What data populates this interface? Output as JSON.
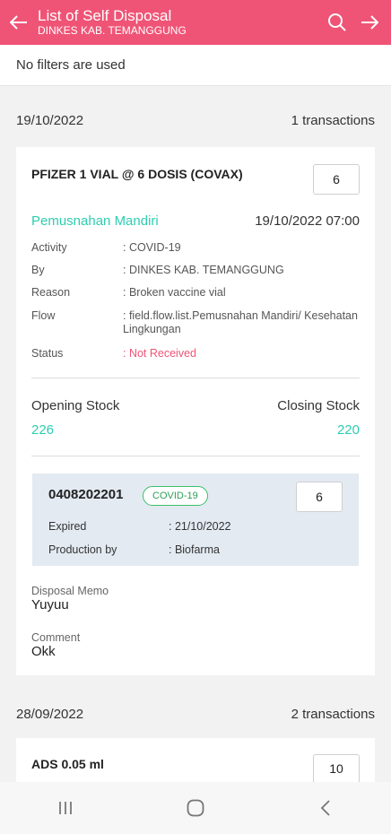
{
  "appbar": {
    "title": "List of Self Disposal",
    "subtitle": "DINKES KAB. TEMANGGUNG",
    "icons": [
      "back-arrow-icon",
      "search-icon",
      "forward-arrow-icon"
    ]
  },
  "filter": {
    "text": "No filters are used"
  },
  "groups": [
    {
      "date": "19/10/2022",
      "count": "1 transactions",
      "item": {
        "product": "PFIZER 1 VIAL @ 6 DOSIS (COVAX)",
        "qty": "6",
        "activity_title": "Pemusnahan Mandiri",
        "datetime": "19/10/2022 07:00",
        "details": {
          "activity": {
            "label": "Activity",
            "value": ": COVID-19"
          },
          "by": {
            "label": "By",
            "value": ": DINKES KAB. TEMANGGUNG"
          },
          "reason": {
            "label": "Reason",
            "value": ": Broken vaccine vial"
          },
          "flow": {
            "label": "Flow",
            "value": ": field.flow.list.Pemusnahan Mandiri/ Kesehatan Lingkungan"
          },
          "status": {
            "label": "Status",
            "value": ": Not Received"
          }
        },
        "stock": {
          "opening_label": "Opening Stock",
          "opening_value": "226",
          "closing_label": "Closing Stock",
          "closing_value": "220"
        },
        "batch": {
          "code": "0408202201",
          "tag": "COVID-19",
          "qty": "6",
          "expired_label": "Expired",
          "expired_value": ": 21/10/2022",
          "production_label": "Production by",
          "production_value": ": Biofarma"
        },
        "memo_label": "Disposal Memo",
        "memo_value": "Yuyuu",
        "comment_label": "Comment",
        "comment_value": "Okk"
      }
    },
    {
      "date": "28/09/2022",
      "count": "2 transactions",
      "item": {
        "product": "ADS 0.05 ml",
        "qty": "10"
      }
    }
  ],
  "colors": {
    "primary": "#ef5476",
    "accent": "#2ecdb0",
    "tag": "#3bbf6a",
    "batch_bg": "#e3eaf2"
  },
  "navbar": {
    "icons": [
      "recent-apps-icon",
      "home-icon",
      "back-icon"
    ]
  }
}
